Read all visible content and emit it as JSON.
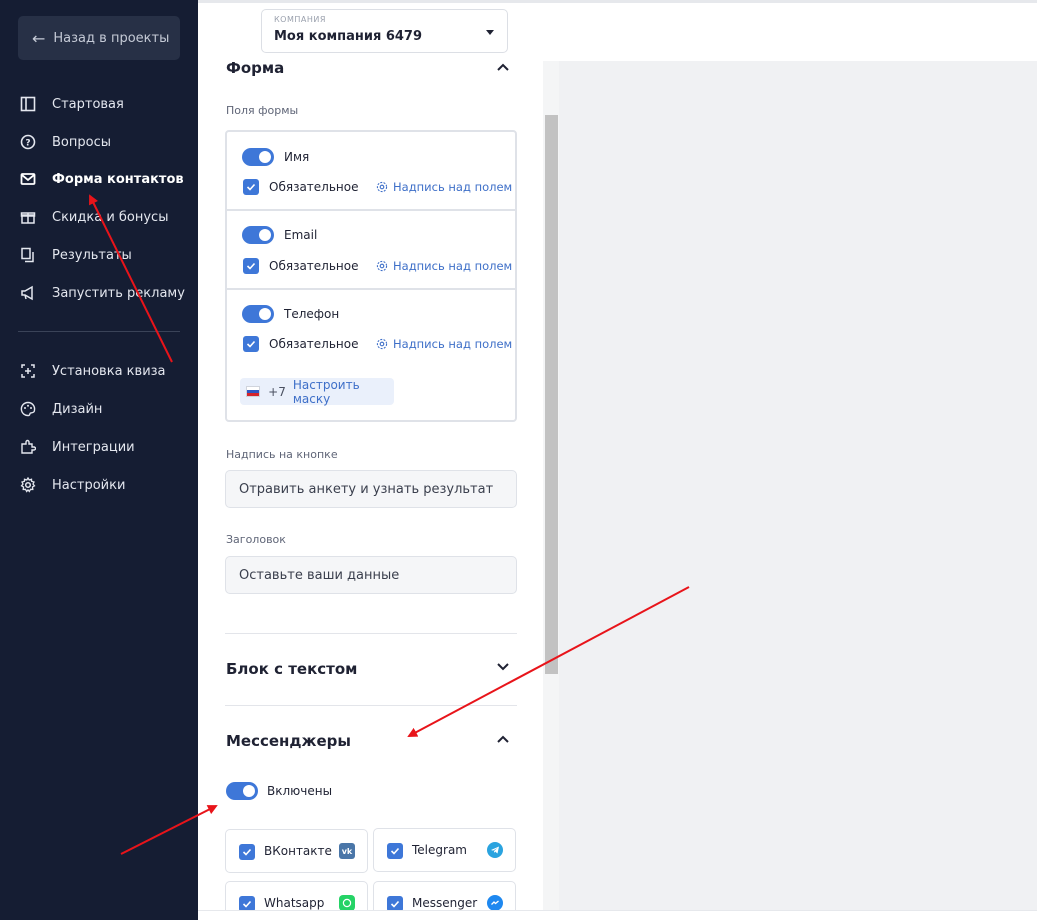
{
  "sidebar": {
    "back_label": "Назад в проекты",
    "items": [
      {
        "label": "Стартовая",
        "icon": "layout-icon"
      },
      {
        "label": "Вопросы",
        "icon": "question-circle-icon"
      },
      {
        "label": "Форма контактов",
        "icon": "envelope-icon",
        "active": true
      },
      {
        "label": "Скидка и бонусы",
        "icon": "gift-icon"
      },
      {
        "label": "Результаты",
        "icon": "files-icon"
      },
      {
        "label": "Запустить рекламу",
        "icon": "megaphone-icon"
      },
      {
        "label": "Установка квиза",
        "icon": "install-icon"
      },
      {
        "label": "Дизайн",
        "icon": "palette-icon"
      },
      {
        "label": "Интеграции",
        "icon": "puzzle-icon"
      },
      {
        "label": "Настройки",
        "icon": "gear-icon"
      }
    ]
  },
  "company": {
    "caption": "КОМПАНИЯ",
    "value": "Моя компания 6479"
  },
  "form_section": {
    "title": "Форма",
    "fields_label": "Поля формы",
    "fields": [
      {
        "name": "Имя",
        "enabled": true,
        "required_label": "Обязательное",
        "required": true,
        "hint_label": "Надпись над полем"
      },
      {
        "name": "Email",
        "enabled": true,
        "required_label": "Обязательное",
        "required": true,
        "hint_label": "Надпись над полем"
      },
      {
        "name": "Телефон",
        "enabled": true,
        "required_label": "Обязательное",
        "required": true,
        "hint_label": "Надпись над полем"
      }
    ],
    "mask": {
      "code": "+7",
      "label": "Настроить маску"
    },
    "button_caption_label": "Надпись на кнопке",
    "button_caption_value": "Отравить анкету и узнать результат",
    "heading_label": "Заголовок",
    "heading_value": "Оставьте ваши данные"
  },
  "text_block_section": {
    "title": "Блок с текстом"
  },
  "messengers_section": {
    "title": "Мессенджеры",
    "enabled_label": "Включены",
    "enabled": true,
    "items": [
      {
        "label": "ВКонтакте",
        "checked": true,
        "icon": "vk-icon",
        "color": "#4a76a8"
      },
      {
        "label": "Telegram",
        "checked": true,
        "icon": "telegram-icon",
        "color": "#2aa3df"
      },
      {
        "label": "Whatsapp",
        "checked": true,
        "icon": "whatsapp-icon",
        "color": "#25d366"
      },
      {
        "label": "Messenger",
        "checked": true,
        "icon": "messenger-icon",
        "color": "#1e88f0"
      }
    ]
  },
  "colors": {
    "accent": "#3e77d8",
    "sidebar_bg": "#151d33",
    "annotation_arrow": "#e8141a"
  }
}
